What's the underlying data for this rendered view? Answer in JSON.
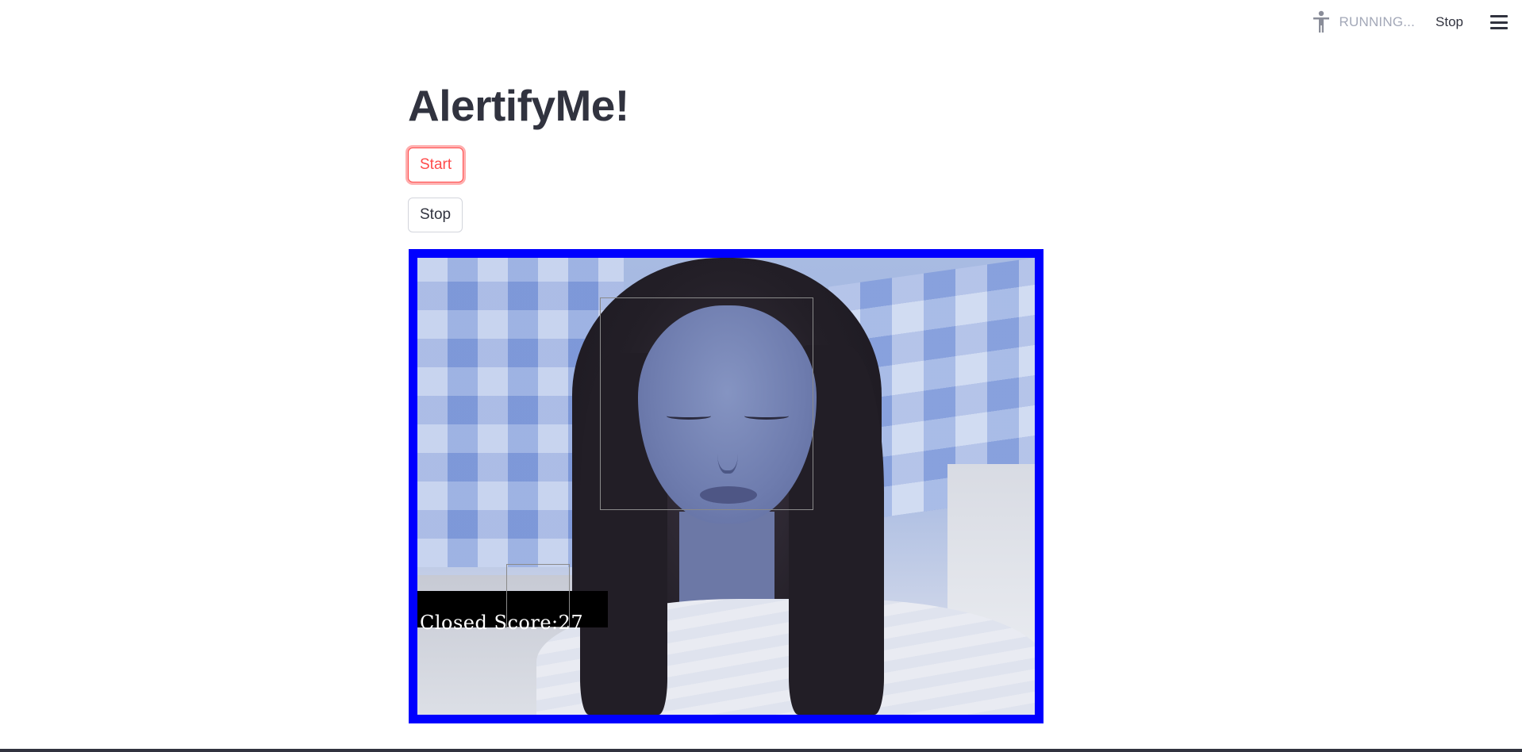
{
  "toolbar": {
    "status": "RUNNING...",
    "stop_label": "Stop",
    "status_icon": "accessibility-running-icon",
    "menu_icon": "hamburger-menu-icon"
  },
  "main": {
    "title": "AlertifyMe!",
    "start_label": "Start",
    "stop_label": "Stop"
  },
  "video": {
    "overlay_status": "Closed",
    "overlay_score": "Score:27",
    "border_color": "#0000ff"
  },
  "colors": {
    "accent": "#ff4b4b",
    "text": "#31333f",
    "muted": "#a3a8b8"
  }
}
